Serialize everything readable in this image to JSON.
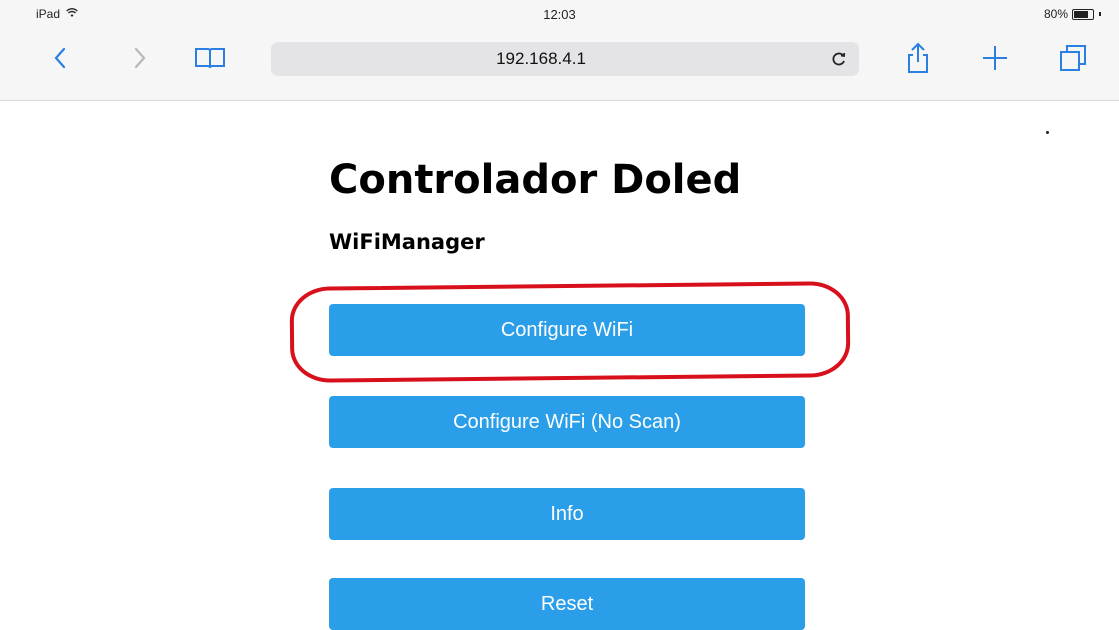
{
  "status_bar": {
    "device": "iPad",
    "time": "12:03",
    "battery_percent": "80%",
    "battery_level": 0.8
  },
  "browser": {
    "url": "192.168.4.1",
    "icons": {
      "back": "chevron-left-icon",
      "forward": "chevron-right-icon",
      "bookmarks": "book-icon",
      "reload": "reload-icon",
      "share": "share-icon",
      "new_tab": "plus-icon",
      "tabs": "tabs-icon"
    }
  },
  "page": {
    "title": "Controlador Doled",
    "subtitle": "WiFiManager",
    "buttons": [
      {
        "label": "Configure WiFi"
      },
      {
        "label": "Configure WiFi (No Scan)"
      },
      {
        "label": "Info"
      },
      {
        "label": "Reset"
      }
    ]
  },
  "colors": {
    "button": "#2a9ee8",
    "highlight": "#d8101c",
    "toolbar_tint": "#2a7fe0"
  }
}
